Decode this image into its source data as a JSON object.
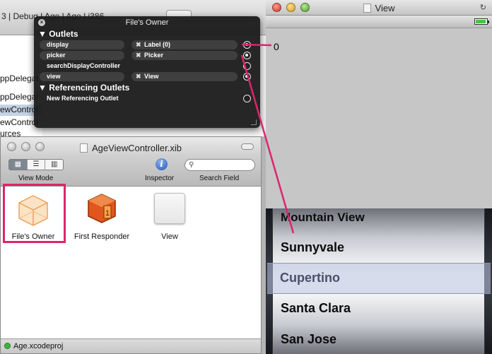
{
  "xcode_bg": {
    "breadcrumb": "3 | Debug | Age | Age | i386",
    "files": [
      "ppDelegat",
      "ppDelegat",
      "ewControl",
      "ewControl",
      "urces"
    ]
  },
  "hud": {
    "title": "File's Owner",
    "outlets_header": "Outlets",
    "outlets": [
      {
        "name": "display",
        "target": "Label (0)",
        "connected": true
      },
      {
        "name": "picker",
        "target": "Picker",
        "connected": true
      },
      {
        "name": "searchDisplayController",
        "target": "",
        "connected": false
      },
      {
        "name": "view",
        "target": "View",
        "connected": true
      }
    ],
    "ref_header": "Referencing Outlets",
    "ref_new": "New Referencing Outlet"
  },
  "doc": {
    "title": "AgeViewController.xib",
    "toolbar": {
      "view_mode": "View Mode",
      "inspector": "Inspector",
      "search_field": "Search Field",
      "search_value": "",
      "search_placeholder": ""
    },
    "objects": [
      {
        "label": "File's Owner",
        "icon": "cube-icon",
        "selected": true
      },
      {
        "label": "First Responder",
        "icon": "first-responder-icon",
        "selected": false
      },
      {
        "label": "View",
        "icon": "view-icon",
        "selected": false
      }
    ],
    "status": "Age.xcodeproj"
  },
  "view_window": {
    "title": "View",
    "display_value": "0",
    "picker_rows": [
      "Mountain View",
      "Sunnyvale",
      "Cupertino",
      "Santa Clara",
      "San Jose"
    ],
    "selected_row": "Cupertino"
  },
  "colors": {
    "connection": "#d9276b",
    "selection": "#d9276b",
    "hud_bg": "#181818"
  }
}
